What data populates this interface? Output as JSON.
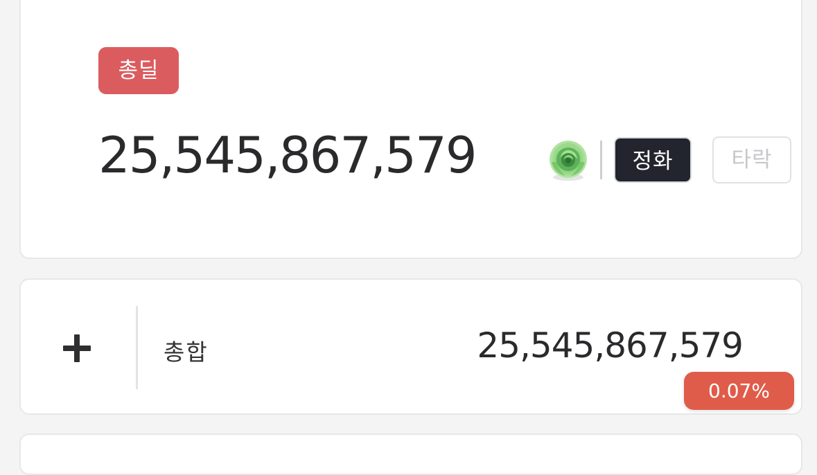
{
  "top_card": {
    "badge_label": "총딜",
    "total_damage": "25,545,867,579",
    "element_icon": "green-rose-icon",
    "buttons": {
      "refine_label": "정화",
      "corrupt_label": "타락"
    }
  },
  "sum_row": {
    "expand_icon": "plus-icon",
    "label": "총합",
    "value": "25,545,867,579",
    "percent": "0.07%"
  },
  "colors": {
    "badge_red": "#db5c5f",
    "percent_red": "#e05c4a",
    "dark_button": "#22252d",
    "text": "#2b2b2e"
  }
}
